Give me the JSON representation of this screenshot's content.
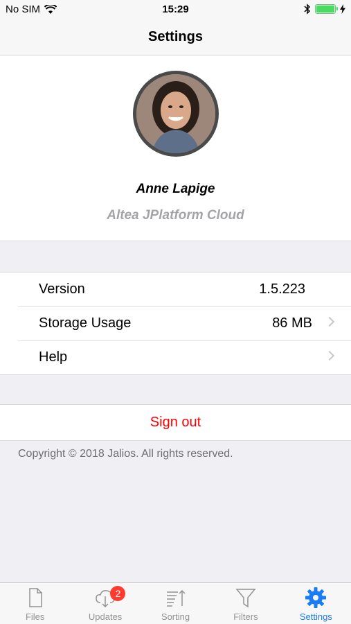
{
  "status_bar": {
    "carrier": "No SIM",
    "time": "15:29"
  },
  "nav": {
    "title": "Settings"
  },
  "profile": {
    "name": "Anne Lapige",
    "organization": "Altea JPlatform Cloud"
  },
  "info_rows": [
    {
      "label": "Version",
      "value": "1.5.223"
    },
    {
      "label": "Storage Usage",
      "value": "86 MB"
    },
    {
      "label": "Help",
      "value": ""
    }
  ],
  "signout_label": "Sign out",
  "copyright": "Copyright © 2018 Jalios. All rights reserved.",
  "tabs": [
    {
      "label": "Files",
      "icon": "file-icon"
    },
    {
      "label": "Updates",
      "icon": "cloud-download-icon",
      "badge": "2"
    },
    {
      "label": "Sorting",
      "icon": "sort-icon"
    },
    {
      "label": "Filters",
      "icon": "funnel-icon"
    },
    {
      "label": "Settings",
      "icon": "gear-icon",
      "active": true
    }
  ],
  "colors": {
    "accent": "#1a7cf5",
    "danger": "#ff0000",
    "badge": "#ff3b30",
    "battery": "#4cd964"
  }
}
